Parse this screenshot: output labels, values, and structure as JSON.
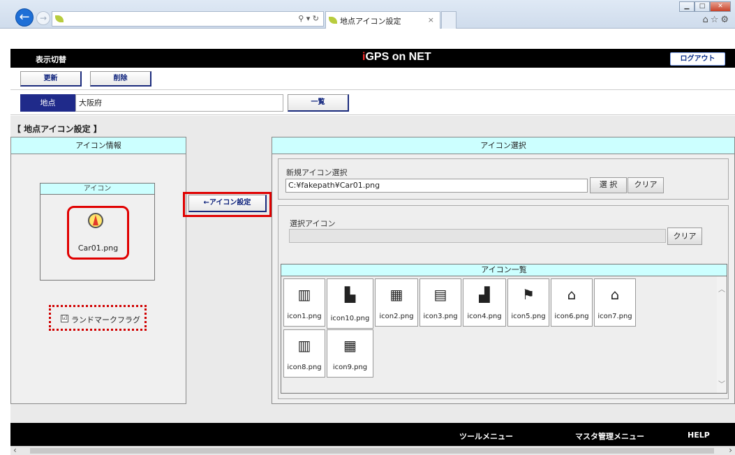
{
  "browser": {
    "address_icons": "⚲ ▾ ↻",
    "tab_title": "地点アイコン設定",
    "tab_close": "×",
    "tools": "⌂☆⚙"
  },
  "header": {
    "toggle_label": "表示切替",
    "brand_i": "i",
    "brand_rest": "GPS on NET",
    "logout_label": "ログアウト"
  },
  "toolbar": {
    "update_label": "更新",
    "delete_label": "削除"
  },
  "place": {
    "label": "地点",
    "value": "大阪府",
    "list_button": "一覧"
  },
  "page_title": "【 地点アイコン設定 】",
  "icon_info": {
    "header": "アイコン情報",
    "icon_box_header": "アイコン",
    "current_icon_file": "Car01.png",
    "landmark_checked": "☑",
    "landmark_label": "ランドマークフラグ"
  },
  "set_button_label": "←アイコン設定",
  "icon_select": {
    "header": "アイコン選択",
    "new_label": "新規アイコン選択",
    "new_value": "C:¥fakepath¥Car01.png",
    "select_button": "選 択",
    "clear_button": "クリア",
    "selected_label": "選択アイコン",
    "selected_value": "",
    "selected_clear": "クリア",
    "list_header": "アイコン一覧",
    "items": [
      {
        "name": "icon1.png",
        "icon": "office-building-icon",
        "glyph": "▥"
      },
      {
        "name": "icon10.png",
        "icon": "hospital-icon",
        "glyph": "▙"
      },
      {
        "name": "icon2.png",
        "icon": "tower-building-icon",
        "glyph": "▦"
      },
      {
        "name": "icon3.png",
        "icon": "factory-icon",
        "glyph": "▤"
      },
      {
        "name": "icon4.png",
        "icon": "school-icon",
        "glyph": "▟"
      },
      {
        "name": "icon5.png",
        "icon": "flag-site-icon",
        "glyph": "⚑"
      },
      {
        "name": "icon6.png",
        "icon": "house-icon",
        "glyph": "⌂"
      },
      {
        "name": "icon7.png",
        "icon": "home-building-icon",
        "glyph": "⌂"
      },
      {
        "name": "icon8.png",
        "icon": "apartment-icon",
        "glyph": "▥"
      },
      {
        "name": "icon9.png",
        "icon": "building-grid-icon",
        "glyph": "▦"
      }
    ]
  },
  "footer": {
    "tool_menu": "ツールメニュー",
    "master_menu": "マスタ管理メニュー",
    "help": "HELP"
  }
}
